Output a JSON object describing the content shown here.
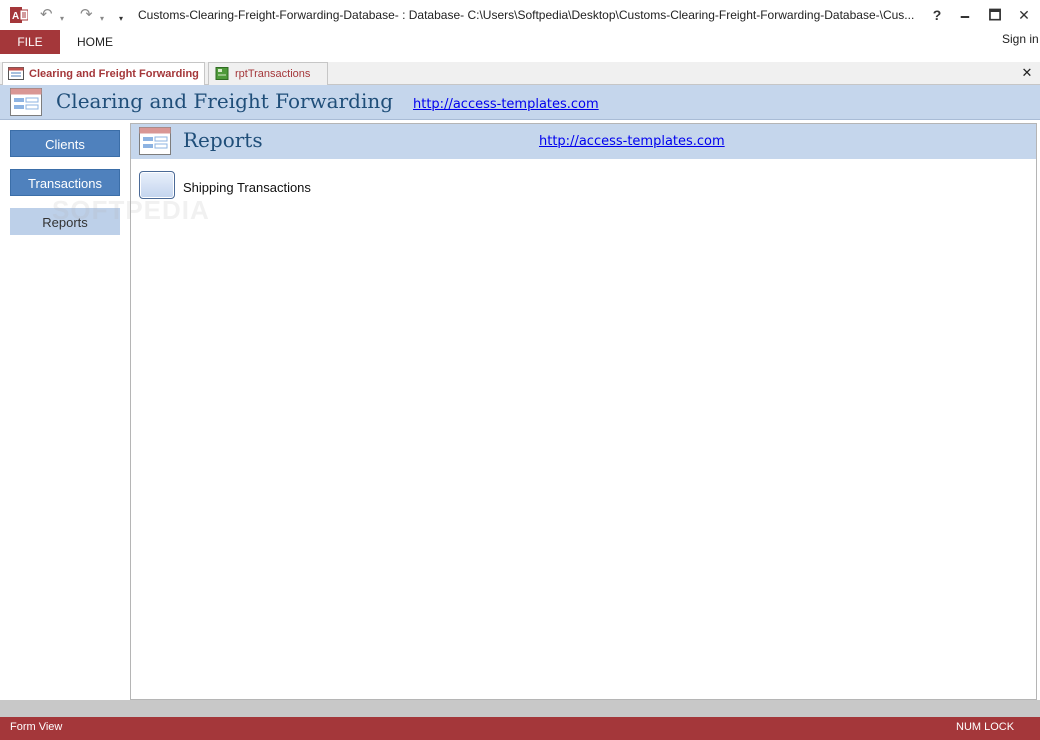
{
  "window": {
    "title": "Customs-Clearing-Freight-Forwarding-Database- : Database- C:\\Users\\Softpedia\\Desktop\\Customs-Clearing-Freight-Forwarding-Database-\\Cus...",
    "help": "?",
    "minimize": "🗕",
    "maximize": "🗖",
    "close": "✕"
  },
  "qat": {
    "undo": "↶",
    "undo_dd": "▾",
    "redo": "↷",
    "redo_dd": "▾",
    "customize": "▾"
  },
  "ribbon": {
    "file_tab": "FILE",
    "home_tab": "HOME",
    "sign_in": "Sign in"
  },
  "document_tabs": [
    {
      "label": "Clearing and Freight Forwarding"
    },
    {
      "label": "rptTransactions"
    }
  ],
  "doc_close": "✕",
  "form": {
    "title": "Clearing and Freight Forwarding",
    "link": "http://access-templates.com"
  },
  "nav": {
    "items": [
      {
        "label": "Clients"
      },
      {
        "label": "Transactions"
      },
      {
        "label": "Reports"
      }
    ]
  },
  "subform": {
    "title": "Reports",
    "link": "http://access-templates.com",
    "report_label": "Shipping Transactions"
  },
  "watermark": "SOFTPEDIA",
  "status": {
    "left": "Form View",
    "right": "NUM LOCK"
  },
  "colors": {
    "accent": "#a4373a",
    "header_bg": "#c5d6ec",
    "nav_button": "#4f81bd",
    "title_text": "#1f4e79"
  }
}
